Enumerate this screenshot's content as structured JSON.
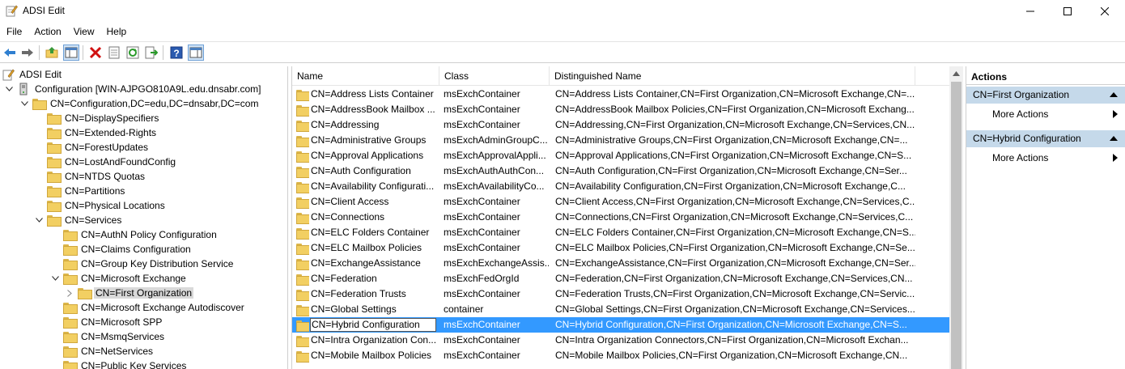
{
  "window": {
    "title": "ADSI Edit"
  },
  "menu": [
    "File",
    "Action",
    "View",
    "Help"
  ],
  "toolbar": {
    "icons": [
      "back-arrow-icon",
      "forward-arrow-icon",
      "up-folder-icon",
      "show-hide-console-tree-icon",
      "delete-icon",
      "properties-icon",
      "refresh-icon",
      "export-list-icon",
      "help-icon",
      "show-hide-action-pane-icon"
    ]
  },
  "tree": {
    "items": [
      {
        "label": "ADSI Edit",
        "level": 0,
        "expander": "",
        "icon": "adsi"
      },
      {
        "label": "Configuration [WIN-AJPGO810A9L.edu.dnsabr.com]",
        "level": 1,
        "expander": "down",
        "icon": "server"
      },
      {
        "label": "CN=Configuration,DC=edu,DC=dnsabr,DC=com",
        "level": 2,
        "expander": "down",
        "icon": "folder"
      },
      {
        "label": "CN=DisplaySpecifiers",
        "level": 3,
        "expander": "",
        "icon": "folder"
      },
      {
        "label": "CN=Extended-Rights",
        "level": 3,
        "expander": "",
        "icon": "folder"
      },
      {
        "label": "CN=ForestUpdates",
        "level": 3,
        "expander": "",
        "icon": "folder"
      },
      {
        "label": "CN=LostAndFoundConfig",
        "level": 3,
        "expander": "",
        "icon": "folder"
      },
      {
        "label": "CN=NTDS Quotas",
        "level": 3,
        "expander": "",
        "icon": "folder"
      },
      {
        "label": "CN=Partitions",
        "level": 3,
        "expander": "",
        "icon": "folder"
      },
      {
        "label": "CN=Physical Locations",
        "level": 3,
        "expander": "",
        "icon": "folder"
      },
      {
        "label": "CN=Services",
        "level": 3,
        "expander": "down",
        "icon": "folder"
      },
      {
        "label": "CN=AuthN Policy Configuration",
        "level": 4,
        "expander": "",
        "icon": "folder"
      },
      {
        "label": "CN=Claims Configuration",
        "level": 4,
        "expander": "",
        "icon": "folder"
      },
      {
        "label": "CN=Group Key Distribution Service",
        "level": 4,
        "expander": "",
        "icon": "folder"
      },
      {
        "label": "CN=Microsoft Exchange",
        "level": 4,
        "expander": "down",
        "icon": "folder"
      },
      {
        "label": "CN=First Organization",
        "level": 5,
        "expander": "right",
        "icon": "folder",
        "selected": true
      },
      {
        "label": "CN=Microsoft Exchange Autodiscover",
        "level": 4,
        "expander": "",
        "icon": "folder"
      },
      {
        "label": "CN=Microsoft SPP",
        "level": 4,
        "expander": "",
        "icon": "folder"
      },
      {
        "label": "CN=MsmqServices",
        "level": 4,
        "expander": "",
        "icon": "folder"
      },
      {
        "label": "CN=NetServices",
        "level": 4,
        "expander": "",
        "icon": "folder"
      },
      {
        "label": "CN=Public Key Services",
        "level": 4,
        "expander": "",
        "icon": "folder"
      }
    ]
  },
  "list": {
    "columns": [
      "Name",
      "Class",
      "Distinguished Name"
    ],
    "rows": [
      {
        "name": "CN=Address Lists Container",
        "class": "msExchContainer",
        "dn": "CN=Address Lists Container,CN=First Organization,CN=Microsoft Exchange,CN=..."
      },
      {
        "name": "CN=AddressBook Mailbox ...",
        "class": "msExchContainer",
        "dn": "CN=AddressBook Mailbox Policies,CN=First Organization,CN=Microsoft Exchang..."
      },
      {
        "name": "CN=Addressing",
        "class": "msExchContainer",
        "dn": "CN=Addressing,CN=First Organization,CN=Microsoft Exchange,CN=Services,CN..."
      },
      {
        "name": "CN=Administrative Groups",
        "class": "msExchAdminGroupC...",
        "dn": "CN=Administrative Groups,CN=First Organization,CN=Microsoft Exchange,CN=..."
      },
      {
        "name": "CN=Approval Applications",
        "class": "msExchApprovalAppli...",
        "dn": "CN=Approval Applications,CN=First Organization,CN=Microsoft Exchange,CN=S..."
      },
      {
        "name": "CN=Auth Configuration",
        "class": "msExchAuthAuthCon...",
        "dn": "CN=Auth Configuration,CN=First Organization,CN=Microsoft Exchange,CN=Ser..."
      },
      {
        "name": "CN=Availability Configurati...",
        "class": "msExchAvailabilityCo...",
        "dn": "CN=Availability Configuration,CN=First Organization,CN=Microsoft Exchange,C..."
      },
      {
        "name": "CN=Client Access",
        "class": "msExchContainer",
        "dn": "CN=Client Access,CN=First Organization,CN=Microsoft Exchange,CN=Services,C..."
      },
      {
        "name": "CN=Connections",
        "class": "msExchContainer",
        "dn": "CN=Connections,CN=First Organization,CN=Microsoft Exchange,CN=Services,C..."
      },
      {
        "name": "CN=ELC Folders Container",
        "class": "msExchContainer",
        "dn": "CN=ELC Folders Container,CN=First Organization,CN=Microsoft Exchange,CN=S..."
      },
      {
        "name": "CN=ELC Mailbox Policies",
        "class": "msExchContainer",
        "dn": "CN=ELC Mailbox Policies,CN=First Organization,CN=Microsoft Exchange,CN=Se..."
      },
      {
        "name": "CN=ExchangeAssistance",
        "class": "msExchExchangeAssis...",
        "dn": "CN=ExchangeAssistance,CN=First Organization,CN=Microsoft Exchange,CN=Ser..."
      },
      {
        "name": "CN=Federation",
        "class": "msExchFedOrgId",
        "dn": "CN=Federation,CN=First Organization,CN=Microsoft Exchange,CN=Services,CN..."
      },
      {
        "name": "CN=Federation Trusts",
        "class": "msExchContainer",
        "dn": "CN=Federation Trusts,CN=First Organization,CN=Microsoft Exchange,CN=Servic..."
      },
      {
        "name": "CN=Global Settings",
        "class": "container",
        "dn": "CN=Global Settings,CN=First Organization,CN=Microsoft Exchange,CN=Services..."
      },
      {
        "name": "CN=Hybrid Configuration",
        "class": "msExchContainer",
        "dn": "CN=Hybrid Configuration,CN=First Organization,CN=Microsoft Exchange,CN=S...",
        "selected": true
      },
      {
        "name": "CN=Intra Organization Con...",
        "class": "msExchContainer",
        "dn": "CN=Intra Organization Connectors,CN=First Organization,CN=Microsoft Exchan..."
      },
      {
        "name": "CN=Mobile Mailbox Policies",
        "class": "msExchContainer",
        "dn": "CN=Mobile Mailbox Policies,CN=First Organization,CN=Microsoft Exchange,CN..."
      }
    ]
  },
  "actions": {
    "title": "Actions",
    "groups": [
      {
        "title": "CN=First Organization",
        "item": "More Actions"
      },
      {
        "title": "CN=Hybrid Configuration",
        "item": "More Actions"
      }
    ]
  },
  "colors": {
    "selection": "#3399ff",
    "actions_group_bg": "#c5d9ea",
    "folder": "#f2cf62"
  }
}
